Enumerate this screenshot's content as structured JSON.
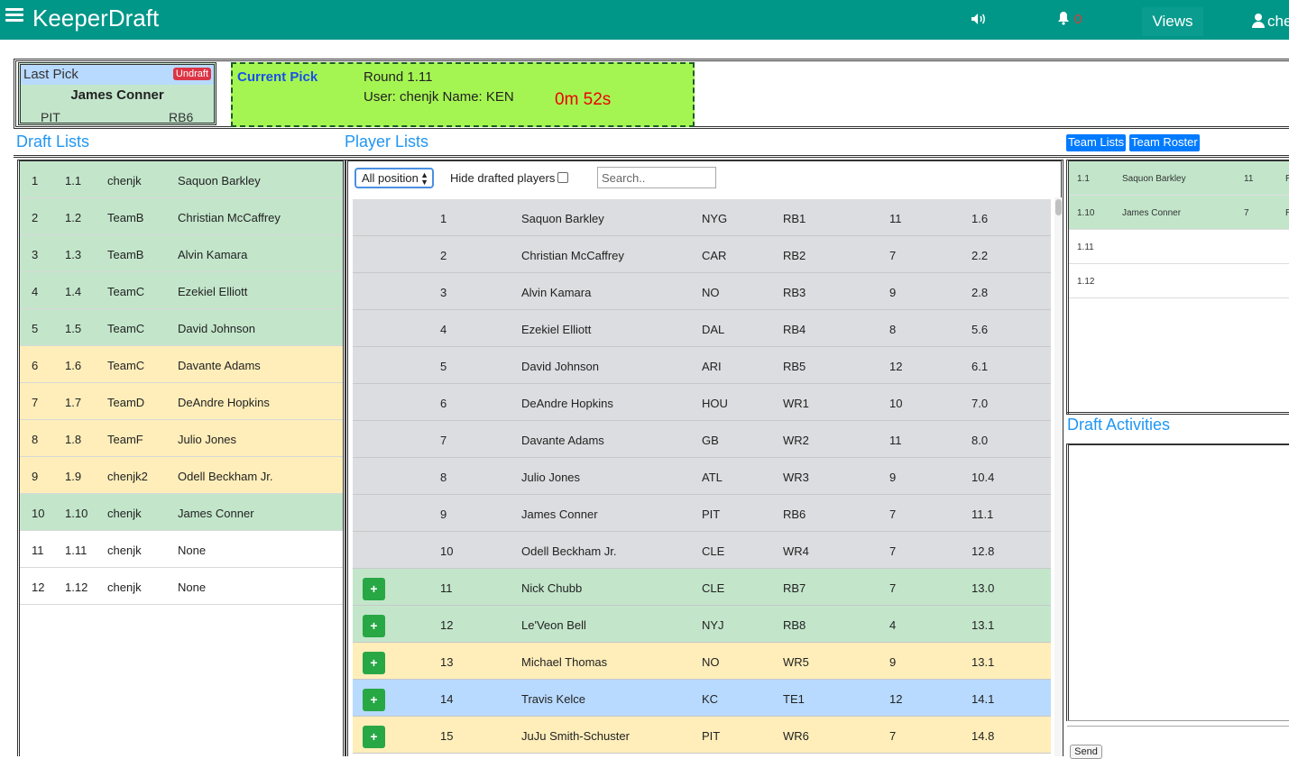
{
  "nav": {
    "brand": "KeeperDraft",
    "bell_count": "0",
    "views_label": "Views",
    "user_label": "che"
  },
  "last_pick": {
    "header": "Last Pick",
    "undraft_label": "Undraft",
    "player": "James Conner",
    "team": "PIT",
    "position": "RB6"
  },
  "current_pick": {
    "title": "Current Pick",
    "round": "Round 1.11",
    "user": "User: chenjk Name: KEN",
    "timer": "0m 52s"
  },
  "sections": {
    "draft_lists": "Draft Lists",
    "player_lists": "Player Lists",
    "draft_activities": "Draft Activities"
  },
  "buttons": {
    "team_lists": "Team Lists",
    "team_roster": "Team Roster",
    "send": "Send",
    "add": "+"
  },
  "filters": {
    "position_select": "All position",
    "hide_drafted": "Hide drafted players",
    "search_placeholder": "Search.."
  },
  "draft_list": [
    {
      "num": "1",
      "pick": "1.1",
      "team": "chenjk",
      "player": "Saquon Barkley",
      "status": "green"
    },
    {
      "num": "2",
      "pick": "1.2",
      "team": "TeamB",
      "player": "Christian McCaffrey",
      "status": "green"
    },
    {
      "num": "3",
      "pick": "1.3",
      "team": "TeamB",
      "player": "Alvin Kamara",
      "status": "green"
    },
    {
      "num": "4",
      "pick": "1.4",
      "team": "TeamC",
      "player": "Ezekiel Elliott",
      "status": "green"
    },
    {
      "num": "5",
      "pick": "1.5",
      "team": "TeamC",
      "player": "David Johnson",
      "status": "green"
    },
    {
      "num": "6",
      "pick": "1.6",
      "team": "TeamC",
      "player": "Davante Adams",
      "status": "yellow"
    },
    {
      "num": "7",
      "pick": "1.7",
      "team": "TeamD",
      "player": "DeAndre Hopkins",
      "status": "yellow"
    },
    {
      "num": "8",
      "pick": "1.8",
      "team": "TeamF",
      "player": "Julio Jones",
      "status": "yellow"
    },
    {
      "num": "9",
      "pick": "1.9",
      "team": "chenjk2",
      "player": "Odell Beckham Jr.",
      "status": "yellow"
    },
    {
      "num": "10",
      "pick": "1.10",
      "team": "chenjk",
      "player": "James Conner",
      "status": "green"
    },
    {
      "num": "11",
      "pick": "1.11",
      "team": "chenjk",
      "player": "None",
      "status": "white"
    },
    {
      "num": "12",
      "pick": "1.12",
      "team": "chenjk",
      "player": "None",
      "status": "white"
    }
  ],
  "players": [
    {
      "rank": "1",
      "name": "Saquon Barkley",
      "team": "NYG",
      "pos": "RB1",
      "bye": "11",
      "adp": "1.6",
      "status": "gray",
      "add": false
    },
    {
      "rank": "2",
      "name": "Christian McCaffrey",
      "team": "CAR",
      "pos": "RB2",
      "bye": "7",
      "adp": "2.2",
      "status": "gray",
      "add": false
    },
    {
      "rank": "3",
      "name": "Alvin Kamara",
      "team": "NO",
      "pos": "RB3",
      "bye": "9",
      "adp": "2.8",
      "status": "gray",
      "add": false
    },
    {
      "rank": "4",
      "name": "Ezekiel Elliott",
      "team": "DAL",
      "pos": "RB4",
      "bye": "8",
      "adp": "5.6",
      "status": "gray",
      "add": false
    },
    {
      "rank": "5",
      "name": "David Johnson",
      "team": "ARI",
      "pos": "RB5",
      "bye": "12",
      "adp": "6.1",
      "status": "gray",
      "add": false
    },
    {
      "rank": "6",
      "name": "DeAndre Hopkins",
      "team": "HOU",
      "pos": "WR1",
      "bye": "10",
      "adp": "7.0",
      "status": "gray",
      "add": false
    },
    {
      "rank": "7",
      "name": "Davante Adams",
      "team": "GB",
      "pos": "WR2",
      "bye": "11",
      "adp": "8.0",
      "status": "gray",
      "add": false
    },
    {
      "rank": "8",
      "name": "Julio Jones",
      "team": "ATL",
      "pos": "WR3",
      "bye": "9",
      "adp": "10.4",
      "status": "gray",
      "add": false
    },
    {
      "rank": "9",
      "name": "James Conner",
      "team": "PIT",
      "pos": "RB6",
      "bye": "7",
      "adp": "11.1",
      "status": "gray",
      "add": false
    },
    {
      "rank": "10",
      "name": "Odell Beckham Jr.",
      "team": "CLE",
      "pos": "WR4",
      "bye": "7",
      "adp": "12.8",
      "status": "gray",
      "add": false
    },
    {
      "rank": "11",
      "name": "Nick Chubb",
      "team": "CLE",
      "pos": "RB7",
      "bye": "7",
      "adp": "13.0",
      "status": "green",
      "add": true
    },
    {
      "rank": "12",
      "name": "Le'Veon Bell",
      "team": "NYJ",
      "pos": "RB8",
      "bye": "4",
      "adp": "13.1",
      "status": "green",
      "add": true
    },
    {
      "rank": "13",
      "name": "Michael Thomas",
      "team": "NO",
      "pos": "WR5",
      "bye": "9",
      "adp": "13.1",
      "status": "yellow",
      "add": true
    },
    {
      "rank": "14",
      "name": "Travis Kelce",
      "team": "KC",
      "pos": "TE1",
      "bye": "12",
      "adp": "14.1",
      "status": "blue",
      "add": true
    },
    {
      "rank": "15",
      "name": "JuJu Smith-Schuster",
      "team": "PIT",
      "pos": "WR6",
      "bye": "7",
      "adp": "14.8",
      "status": "yellow",
      "add": true
    }
  ],
  "team_list": [
    {
      "pick": "1.1",
      "player": "Saquon Barkley",
      "bye": "11",
      "pos": "R",
      "status": "green"
    },
    {
      "pick": "1.10",
      "player": "James Conner",
      "bye": "7",
      "pos": "R",
      "status": "green"
    },
    {
      "pick": "1.11",
      "player": "",
      "bye": "",
      "pos": "",
      "status": "white"
    },
    {
      "pick": "1.12",
      "player": "",
      "bye": "",
      "pos": "",
      "status": "white"
    }
  ]
}
